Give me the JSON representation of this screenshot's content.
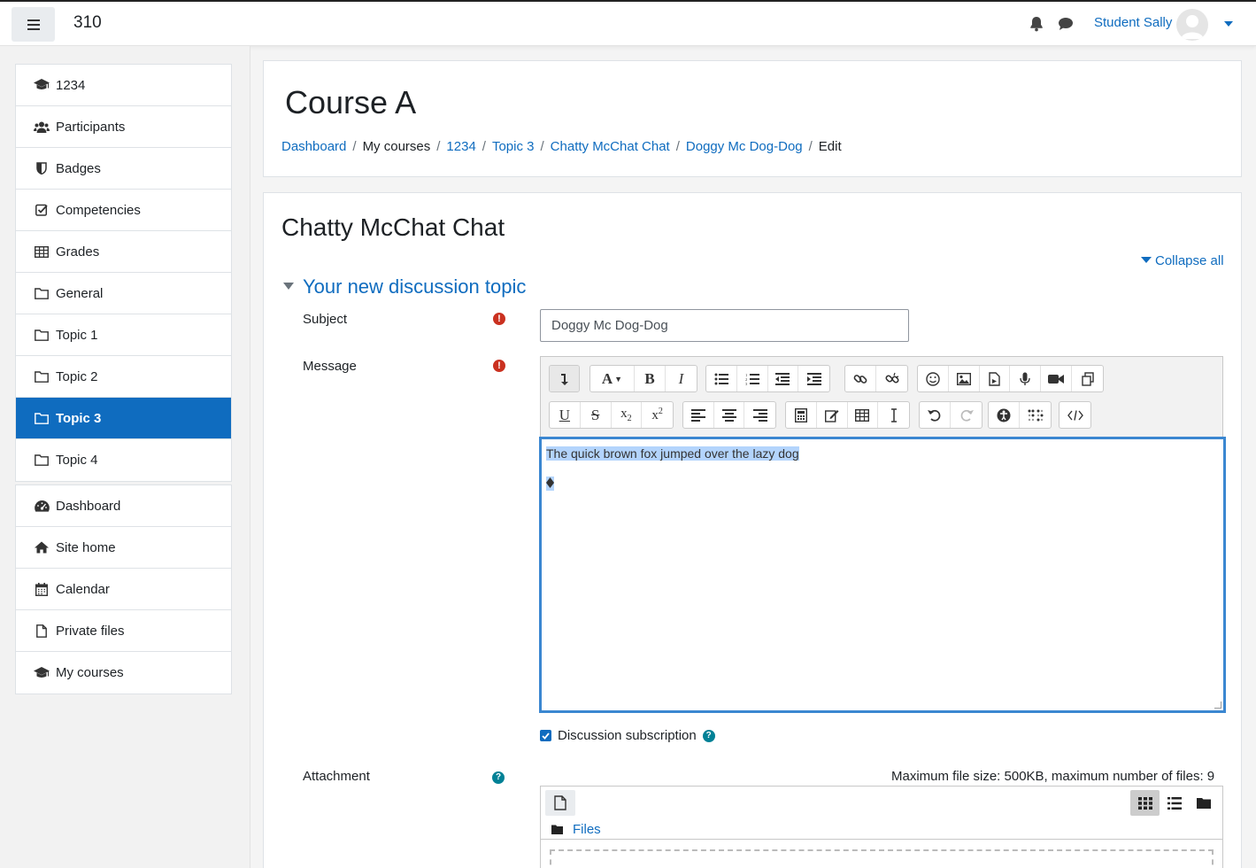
{
  "navbar": {
    "site_name": "310",
    "user_name": "Student Sally"
  },
  "sidebar": {
    "course_items": [
      {
        "label": "1234",
        "icon": "graduation-cap-icon"
      },
      {
        "label": "Participants",
        "icon": "users-icon"
      },
      {
        "label": "Badges",
        "icon": "shield-icon"
      },
      {
        "label": "Competencies",
        "icon": "check-square-icon"
      },
      {
        "label": "Grades",
        "icon": "table-icon"
      },
      {
        "label": "General",
        "icon": "folder-icon"
      },
      {
        "label": "Topic 1",
        "icon": "folder-icon"
      },
      {
        "label": "Topic 2",
        "icon": "folder-icon"
      },
      {
        "label": "Topic 3",
        "icon": "folder-icon",
        "active": true
      },
      {
        "label": "Topic 4",
        "icon": "folder-icon"
      }
    ],
    "site_items": [
      {
        "label": "Dashboard",
        "icon": "tachometer-icon"
      },
      {
        "label": "Site home",
        "icon": "home-icon"
      },
      {
        "label": "Calendar",
        "icon": "calendar-icon"
      },
      {
        "label": "Private files",
        "icon": "file-icon"
      },
      {
        "label": "My courses",
        "icon": "graduation-cap-icon"
      }
    ]
  },
  "header": {
    "course_title": "Course A",
    "breadcrumb": [
      "Dashboard",
      "My courses",
      "1234",
      "Topic 3",
      "Chatty McChat Chat",
      "Doggy Mc Dog-Dog",
      "Edit"
    ]
  },
  "form": {
    "forum_title": "Chatty McChat Chat",
    "collapse_all": "Collapse all",
    "section_title": "Your new discussion topic",
    "subject_label": "Subject",
    "subject_value": "Doggy Mc Dog-Dog",
    "message_label": "Message",
    "message_text": "The quick brown fox jumped over the lazy dog",
    "subscription_label": "Discussion subscription",
    "attachment_label": "Attachment",
    "max_size": "Maximum file size: 500KB, maximum number of files: 9",
    "files_link": "Files"
  },
  "colors": {
    "accent": "#0f6cbf",
    "required": "#ca3120",
    "help": "#008196"
  }
}
